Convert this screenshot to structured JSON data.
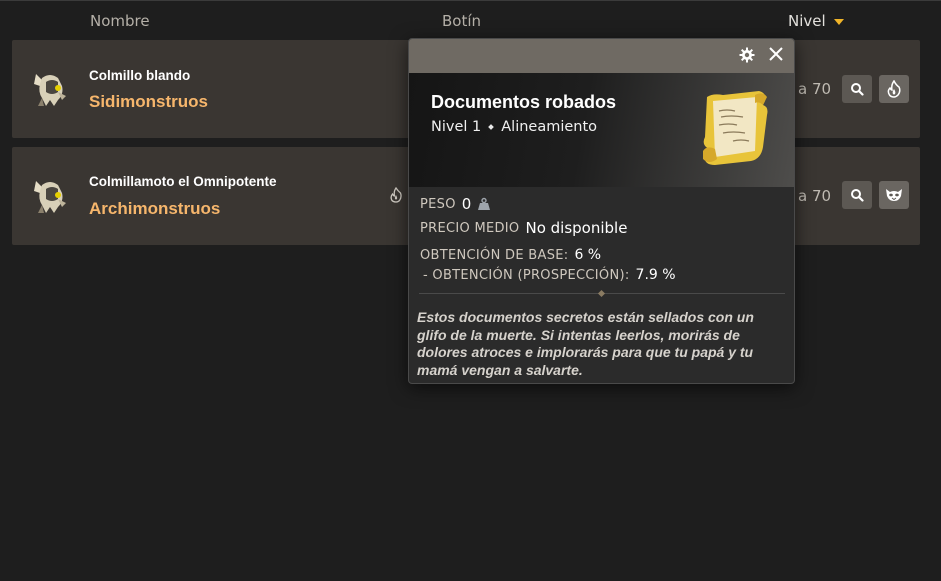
{
  "header": {
    "col_name": "Nombre",
    "col_loot": "Botín",
    "col_level": "Nivel"
  },
  "rows": [
    {
      "name": "Colmillo blando",
      "type": "Sidimonstruos",
      "level_text": "a 70",
      "extra_icon": "flame-icon"
    },
    {
      "name": "Colmillamoto el Omnipotente",
      "type": "Archimonstruos",
      "level_text": "a 70",
      "extra_icon": "mask-icon"
    }
  ],
  "tooltip": {
    "title": "Documentos robados",
    "level": "Nivel 1",
    "alignment": "Alineamiento",
    "weight_label": "PESO",
    "weight_value": "0",
    "price_label": "PRECIO MEDIO",
    "price_value": "No disponible",
    "base_drop_label": "OBTENCIÓN DE BASE:",
    "base_drop_value": "6 %",
    "prospect_drop_label": "- OBTENCIÓN (PROSPECCIÓN):",
    "prospect_drop_value": "7.9 %",
    "description": "Estos documentos secretos están sellados con un glifo de la muerte. Si intentas leerlos, morirás de dolores atroces e implorarás para que tu papá y tu mamá vengan a salvarte."
  },
  "colors": {
    "accent": "#f0b429",
    "monster_type": "#f6b66c",
    "row_bg": "#3a3632",
    "page_bg": "#1e1e1e"
  }
}
